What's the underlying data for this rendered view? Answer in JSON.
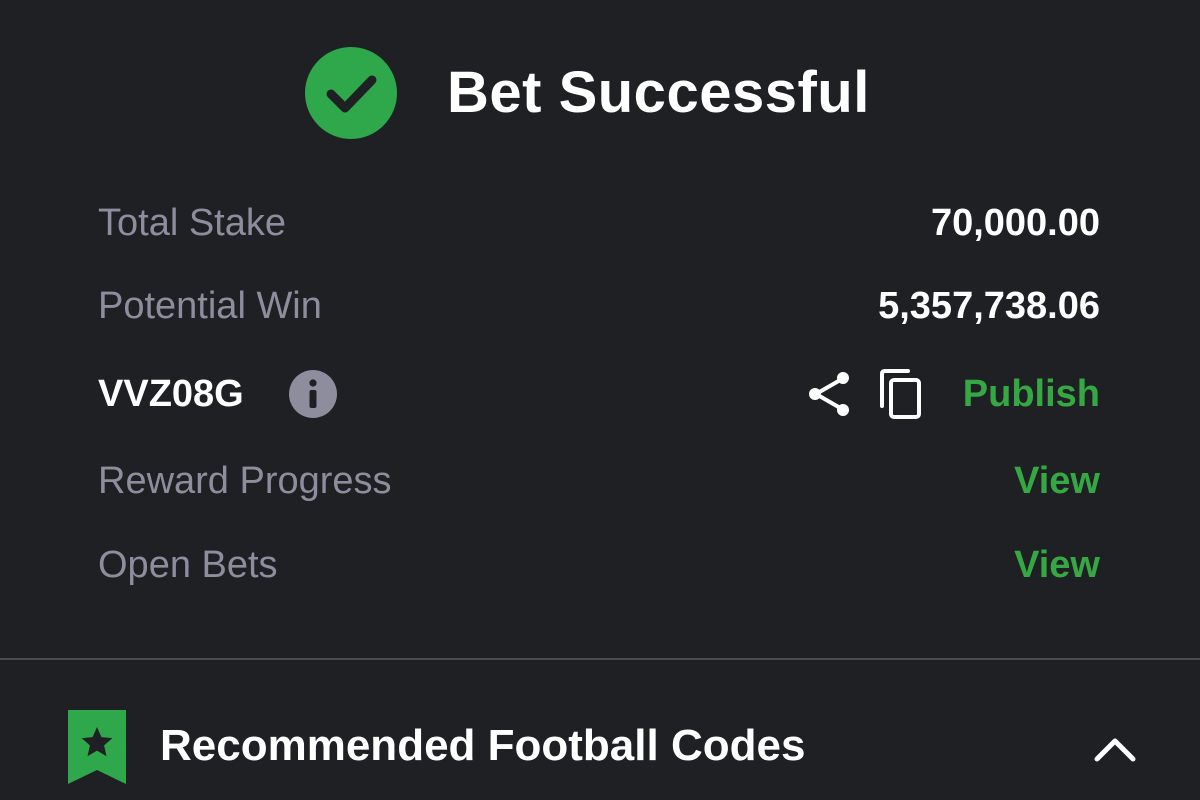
{
  "header": {
    "title": "Bet Successful",
    "icon": "check-circle-icon",
    "icon_color": "#2ea84a"
  },
  "summary": {
    "total_stake": {
      "label": "Total Stake",
      "value": "70,000.00"
    },
    "potential_win": {
      "label": "Potential Win",
      "value": "5,357,738.06"
    },
    "booking": {
      "code": "VVZ08G",
      "info_icon": "info-icon",
      "share_icon": "share-icon",
      "copy_icon": "copy-icon",
      "publish_label": "Publish"
    },
    "reward_progress": {
      "label": "Reward Progress",
      "action": "View"
    },
    "open_bets": {
      "label": "Open Bets",
      "action": "View"
    }
  },
  "recommended": {
    "title": "Recommended Football Codes",
    "icon": "bookmark-star-icon",
    "toggle_icon": "chevron-up-icon"
  },
  "colors": {
    "background": "#1f2024",
    "accent_green": "#35a844",
    "label_gray": "#8d8d9e",
    "text_white": "#ffffff"
  }
}
